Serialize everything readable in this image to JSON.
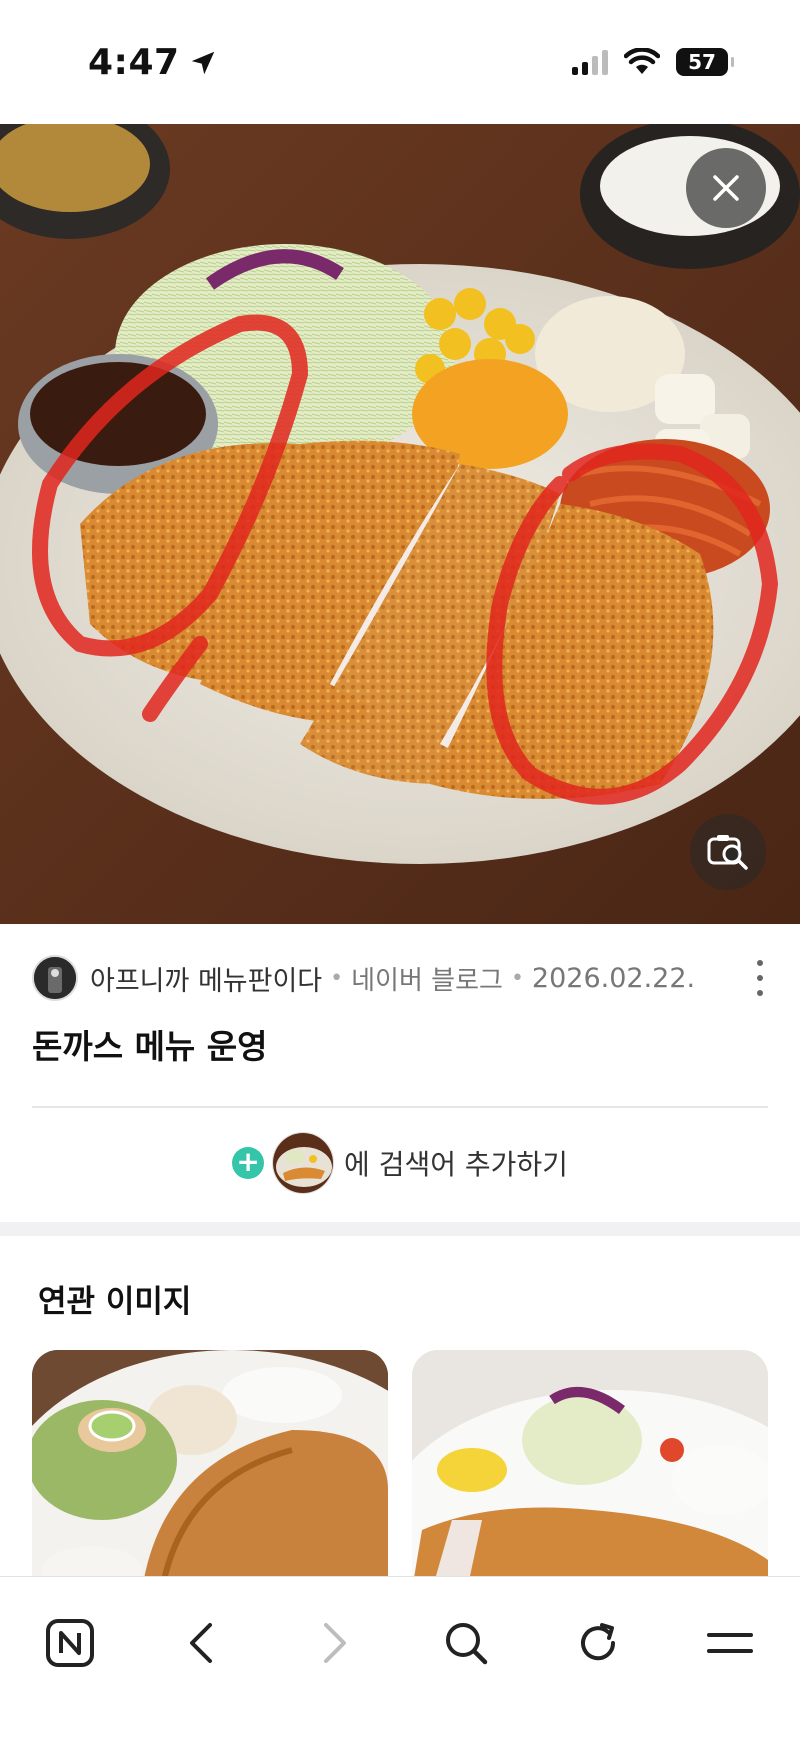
{
  "status_bar": {
    "time": "4:47",
    "battery": "57"
  },
  "post": {
    "author": "아프니까 메뉴판이다",
    "source": "네이버 블로그",
    "date": "2026.02.22.",
    "separator": "•",
    "title": "돈까스 메뉴 운영"
  },
  "add_search": {
    "plus": "+",
    "label": "에 검색어 추가하기"
  },
  "related": {
    "title": "연관 이미지"
  },
  "icons": {
    "location": "location-arrow-icon",
    "signal": "cellular-signal-icon",
    "wifi": "wifi-icon",
    "battery": "battery-icon",
    "close": "close-icon",
    "lens": "image-search-icon",
    "more": "more-vertical-icon",
    "home": "naver-home-icon",
    "back": "back-arrow-icon",
    "forward": "forward-arrow-icon",
    "search": "search-icon",
    "refresh": "refresh-icon",
    "menu": "menu-icon"
  },
  "colors": {
    "accent_plus": "#35c5a8",
    "forward_disabled": "#bdbdbd"
  }
}
